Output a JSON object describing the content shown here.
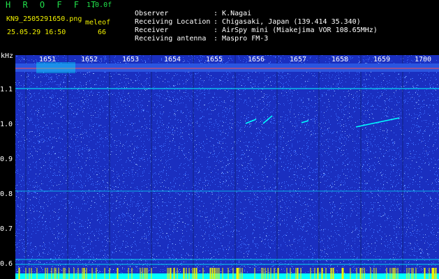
{
  "header": {
    "logo": "H R O F F T",
    "version": "1.0.0f",
    "filename": "KN9_2505291650.png",
    "unit": "meleof",
    "datetime": "25.05.29 16:50",
    "value": "66"
  },
  "meta": [
    {
      "label": "Observer",
      "sep": ":",
      "value": "K.Nagai"
    },
    {
      "label": "Receiving Location",
      "sep": ":",
      "value": "Chigasaki, Japan (139.414 35.340)"
    },
    {
      "label": "Receiver",
      "sep": ":",
      "value": "AirSpy mini (Miakejima VOR 108.65MHz)"
    },
    {
      "label": "Receiving antenna",
      "sep": ":",
      "value": "Maspro FM-3"
    }
  ],
  "y_axis": {
    "unit": "kHz",
    "ticks": [
      "1.1",
      "1.0",
      "0.9",
      "0.8",
      "0.7",
      "0.6"
    ],
    "extra_ticks": [
      "0.7",
      "0.6"
    ]
  },
  "x_axis": {
    "ticks": [
      "1651",
      "1652",
      "1653",
      "1654",
      "1655",
      "1656",
      "1657",
      "1658",
      "1659",
      "1700"
    ]
  },
  "colors": {
    "background": "#1a2fc0",
    "noise": "#3a6cff",
    "signal": "#00ffff",
    "carrier": "#ff5050",
    "text": "#ffffff",
    "accent": "#f0f000",
    "logo": "#21e04a"
  }
}
